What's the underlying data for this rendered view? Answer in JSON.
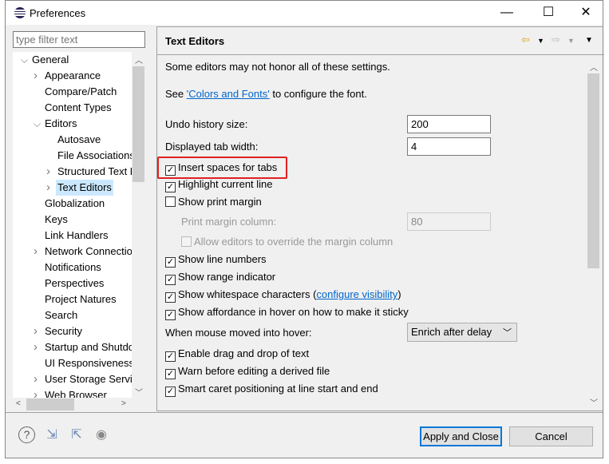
{
  "window": {
    "title": "Preferences",
    "minimize": "—",
    "maximize": "☐",
    "close": "✕"
  },
  "filter": {
    "placeholder": "type filter text"
  },
  "tree": [
    {
      "label": "General",
      "level": 0,
      "twisty": "expanded"
    },
    {
      "label": "Appearance",
      "level": 1,
      "twisty": "collapsed"
    },
    {
      "label": "Compare/Patch",
      "level": 1,
      "twisty": "none"
    },
    {
      "label": "Content Types",
      "level": 1,
      "twisty": "none"
    },
    {
      "label": "Editors",
      "level": 1,
      "twisty": "expanded"
    },
    {
      "label": "Autosave",
      "level": 2,
      "twisty": "none"
    },
    {
      "label": "File Associations",
      "level": 2,
      "twisty": "none"
    },
    {
      "label": "Structured Text E",
      "level": 2,
      "twisty": "collapsed"
    },
    {
      "label": "Text Editors",
      "level": 2,
      "twisty": "collapsed",
      "selected": true
    },
    {
      "label": "Globalization",
      "level": 1,
      "twisty": "none"
    },
    {
      "label": "Keys",
      "level": 1,
      "twisty": "none"
    },
    {
      "label": "Link Handlers",
      "level": 1,
      "twisty": "none"
    },
    {
      "label": "Network Connectio",
      "level": 1,
      "twisty": "collapsed"
    },
    {
      "label": "Notifications",
      "level": 1,
      "twisty": "none"
    },
    {
      "label": "Perspectives",
      "level": 1,
      "twisty": "none"
    },
    {
      "label": "Project Natures",
      "level": 1,
      "twisty": "none"
    },
    {
      "label": "Search",
      "level": 1,
      "twisty": "none"
    },
    {
      "label": "Security",
      "level": 1,
      "twisty": "collapsed"
    },
    {
      "label": "Startup and Shutdo",
      "level": 1,
      "twisty": "collapsed"
    },
    {
      "label": "UI Responsiveness",
      "level": 1,
      "twisty": "none"
    },
    {
      "label": "User Storage Servi",
      "level": 1,
      "twisty": "collapsed"
    },
    {
      "label": "Web Browser",
      "level": 1,
      "twisty": "collapsed"
    }
  ],
  "page": {
    "title": "Text Editors",
    "note": "Some editors may not honor all of these settings.",
    "see_pre": "See ",
    "see_link": "'Colors and Fonts'",
    "see_post": " to configure the font.",
    "undo_label": "Undo history size:",
    "undo_value": "200",
    "tab_label": "Displayed tab width:",
    "tab_value": "4",
    "insert_spaces": {
      "label": "Insert spaces for tabs",
      "checked": true
    },
    "highlight_line": {
      "label": "Highlight current line",
      "checked": true
    },
    "print_margin": {
      "label": "Show print margin",
      "checked": false
    },
    "margin_col_label": "Print margin column:",
    "margin_col_value": "80",
    "allow_override": {
      "label": "Allow editors to override the margin column",
      "checked": false
    },
    "line_numbers": {
      "label": "Show line numbers",
      "checked": true
    },
    "range_indicator": {
      "label": "Show range indicator",
      "checked": true
    },
    "whitespace": {
      "label": "Show whitespace characters (",
      "link": "configure visibility",
      "post": ")",
      "checked": true
    },
    "affordance": {
      "label": "Show affordance in hover on how to make it sticky",
      "checked": true
    },
    "hover_label": "When mouse moved into hover:",
    "hover_value": "Enrich after delay",
    "drag_drop": {
      "label": "Enable drag and drop of text",
      "checked": true
    },
    "warn_derived": {
      "label": "Warn before editing a derived file",
      "checked": true
    },
    "smart_caret": {
      "label": "Smart caret positioning at line start and end",
      "checked": true
    }
  },
  "buttons": {
    "apply_close": "Apply and Close",
    "cancel": "Cancel"
  },
  "colors": {
    "highlight": "#e02020",
    "selection": "#cce8ff",
    "link": "#0066cc",
    "default_button": "#0078d7"
  }
}
